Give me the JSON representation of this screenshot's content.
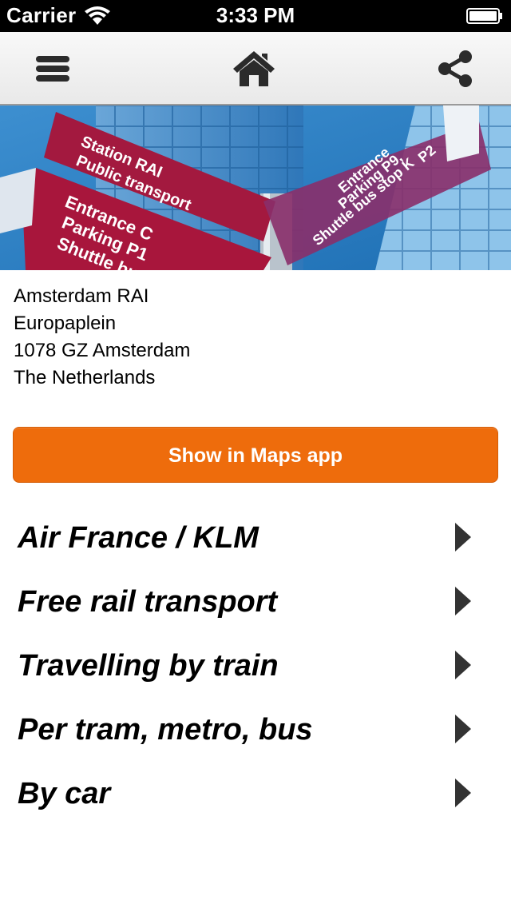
{
  "status_bar": {
    "carrier": "Carrier",
    "time": "3:33 PM",
    "icons": [
      "wifi-icon",
      "battery-icon"
    ]
  },
  "nav": {
    "icons": [
      "menu-icon",
      "home-icon",
      "share-icon"
    ]
  },
  "hero": {
    "signs": {
      "left_top": [
        "Station RAI",
        "Public transport"
      ],
      "left_bottom": [
        "Entrance C",
        "Parking P1",
        "Shuttle bus st"
      ],
      "right": [
        "Entrance",
        "Parking P9,",
        "Shuttle bus stop K",
        "P2"
      ]
    }
  },
  "address": {
    "name": "Amsterdam RAI",
    "street": "Europaplein",
    "postal_city": "1078 GZ Amsterdam",
    "country": "The Netherlands"
  },
  "maps_button": {
    "label": "Show in Maps app",
    "color": "#ee6c0c"
  },
  "list": [
    {
      "label": "Air France / KLM",
      "icon": "chevron-right-icon"
    },
    {
      "label": "Free rail transport",
      "icon": "chevron-right-icon"
    },
    {
      "label": "Travelling by train",
      "icon": "chevron-right-icon"
    },
    {
      "label": "Per tram, metro, bus",
      "icon": "chevron-right-icon"
    },
    {
      "label": "By car",
      "icon": "chevron-right-icon"
    }
  ]
}
